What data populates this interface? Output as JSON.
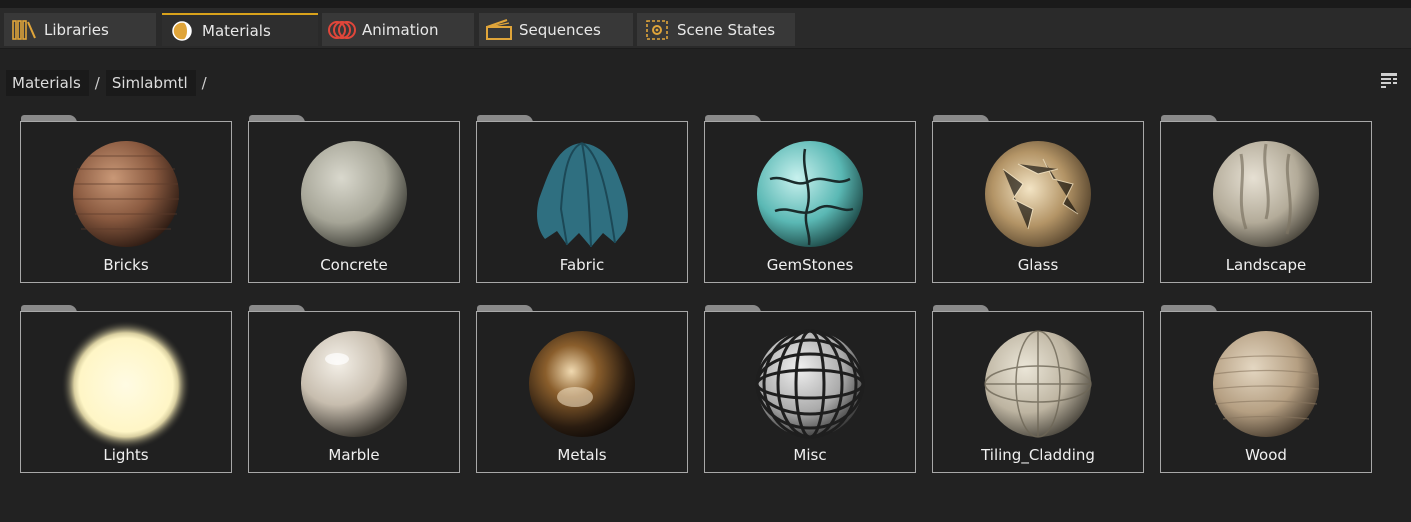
{
  "tabs": [
    {
      "label": "Libraries",
      "icon": "libraries-icon"
    },
    {
      "label": "Materials",
      "icon": "materials-icon"
    },
    {
      "label": "Animation",
      "icon": "animation-icon"
    },
    {
      "label": "Sequences",
      "icon": "sequences-icon"
    },
    {
      "label": "Scene States",
      "icon": "scene-states-icon"
    }
  ],
  "active_tab": "Materials",
  "breadcrumb": [
    "Materials",
    "Simlabmtl"
  ],
  "breadcrumb_separator": "/",
  "view_toggle_icon": "list-view-icon",
  "accent_color": "#d9a21b",
  "folders": [
    {
      "label": "Bricks"
    },
    {
      "label": "Concrete"
    },
    {
      "label": "Fabric"
    },
    {
      "label": "GemStones"
    },
    {
      "label": "Glass"
    },
    {
      "label": "Landscape"
    },
    {
      "label": "Lights"
    },
    {
      "label": "Marble"
    },
    {
      "label": "Metals"
    },
    {
      "label": "Misc"
    },
    {
      "label": "Tiling_Cladding"
    },
    {
      "label": "Wood"
    }
  ]
}
